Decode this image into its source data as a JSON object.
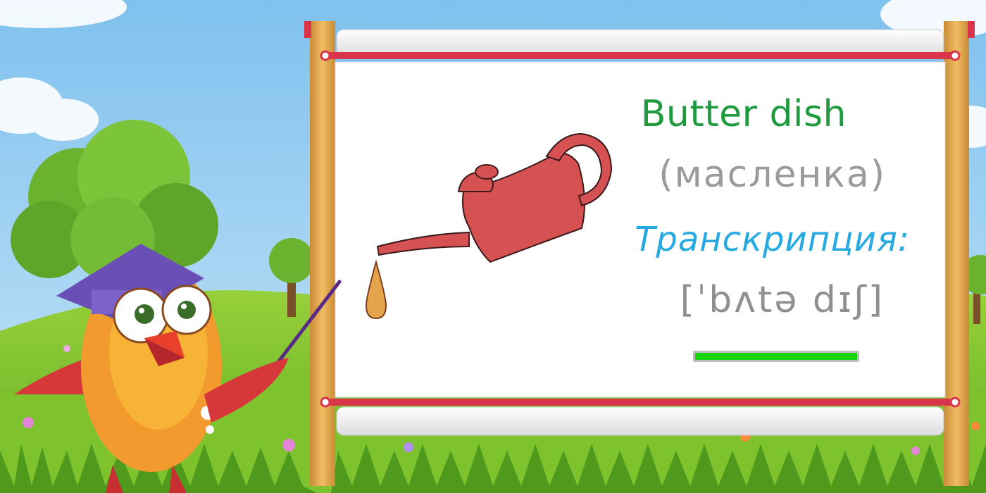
{
  "card": {
    "word": "Butter dish",
    "translation": "(масленка)",
    "transcription_label": "Транскрипция:",
    "transcription": "[ˈbʌtə dɪʃ]",
    "progress": 1.0
  },
  "colors": {
    "word": "#1f9a3f",
    "translation": "#9a9a9a",
    "transcription_label": "#27a9e1",
    "transcription": "#8f8f8f",
    "progress": "#16d40f",
    "board_frame": "#d9344a",
    "sky": "#8ec8ee",
    "grass": "#6cbb2c"
  },
  "icons": {
    "illustration": "oil-can-icon",
    "mascot": "bird-teacher-mascot"
  }
}
